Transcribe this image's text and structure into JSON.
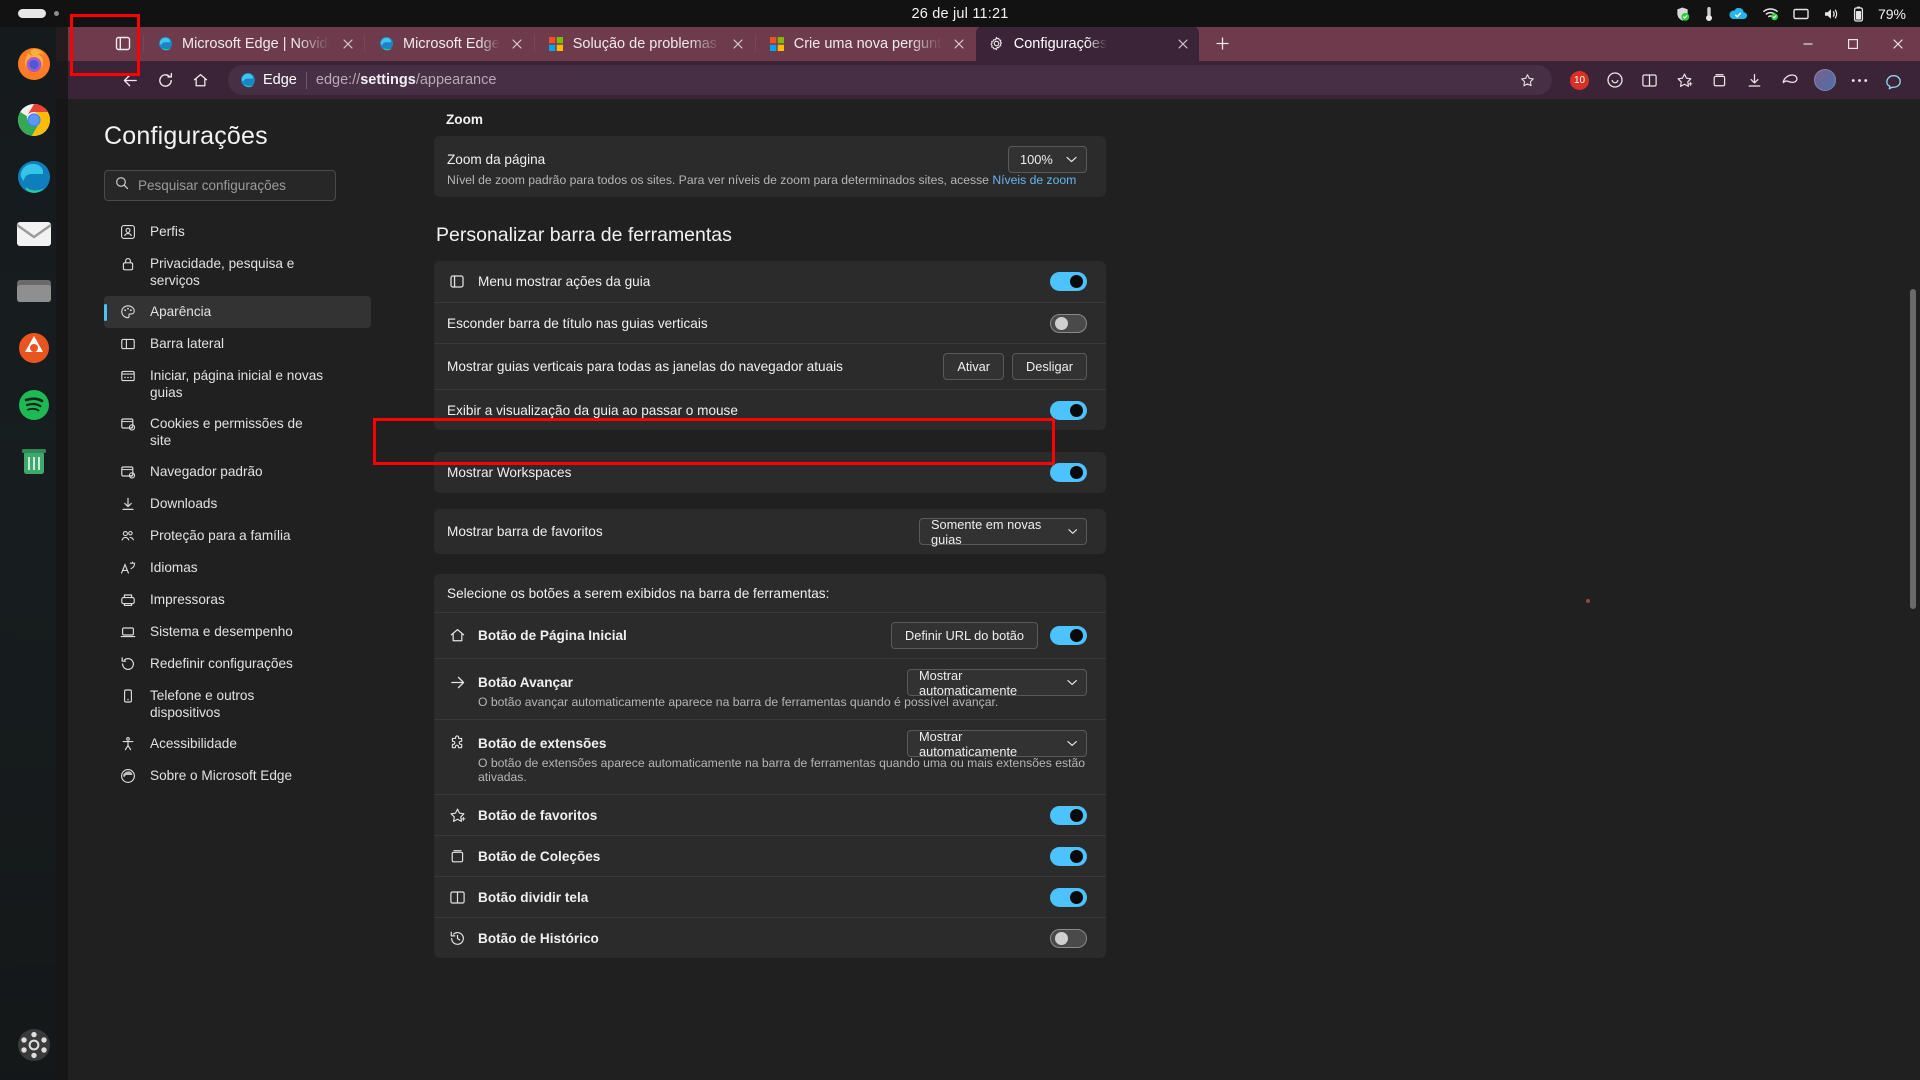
{
  "system": {
    "clock": "26 de jul  11:21",
    "battery_percent": "79%",
    "tray_icons": [
      "shield-check-icon",
      "thermometer-icon",
      "onedrive-cloud-icon",
      "wifi-icon",
      "tray-extra-icon",
      "speaker-icon",
      "battery-icon"
    ]
  },
  "dock": {
    "items": [
      {
        "name": "firefox",
        "label": "Firefox"
      },
      {
        "name": "chrome",
        "label": "Google Chrome"
      },
      {
        "name": "edge",
        "label": "Microsoft Edge"
      },
      {
        "name": "thunderbird",
        "label": "Thunderbird Mail"
      },
      {
        "name": "files",
        "label": "Arquivos"
      },
      {
        "name": "ubuntu-software",
        "label": "Ubuntu Software"
      },
      {
        "name": "spotify",
        "label": "Spotify"
      },
      {
        "name": "trash",
        "label": "Lixeira"
      },
      {
        "name": "show-apps",
        "label": "Mostrar Aplicativos"
      }
    ]
  },
  "browser": {
    "tab_actions_tooltip": "Ações da guia",
    "new_tab_label": "+",
    "tabs": [
      {
        "title": "Microsoft Edge | Novidades",
        "favicon": "edge-icon",
        "active": false,
        "closable": true
      },
      {
        "title": "Microsoft Edge",
        "favicon": "edge-icon",
        "active": false,
        "closable": true
      },
      {
        "title": "Solução de problemas - Su",
        "favicon": "microsoft-icon",
        "active": false,
        "closable": true
      },
      {
        "title": "Crie uma nova pergunta o",
        "favicon": "microsoft-icon",
        "active": false,
        "closable": true
      },
      {
        "title": "Configurações",
        "favicon": "gear-icon",
        "active": true,
        "closable": true
      }
    ],
    "window_controls": [
      "minimize",
      "maximize",
      "close"
    ],
    "toolbar": {
      "back": "Voltar",
      "refresh": "Atualizar",
      "home": "Página inicial",
      "omnibox_brand": "Edge",
      "url_prefix": "edge://",
      "url_bold": "settings",
      "url_suffix": "/appearance",
      "favorite_star": "Adicionar aos favoritos",
      "extension_badge": "10",
      "icons": [
        "star-icon",
        "extension-badge-icon",
        "copilot-bubble-icon",
        "split-screen-icon",
        "favorites-icon",
        "collections-icon",
        "downloads-icon",
        "browser-essentials-icon",
        "profile-avatar",
        "more-icon",
        "copilot-icon"
      ]
    }
  },
  "settings": {
    "title": "Configurações",
    "search": {
      "placeholder": "Pesquisar configurações",
      "value": ""
    },
    "nav": [
      {
        "label": "Perfis",
        "icon": "profile-icon",
        "selected": false
      },
      {
        "label": "Privacidade, pesquisa e serviços",
        "icon": "lock-icon",
        "selected": false
      },
      {
        "label": "Aparência",
        "icon": "palette-icon",
        "selected": true
      },
      {
        "label": "Barra lateral",
        "icon": "sidebar-icon",
        "selected": false
      },
      {
        "label": "Iniciar, página inicial e novas guias",
        "icon": "start-page-icon",
        "selected": false
      },
      {
        "label": "Cookies e permissões de site",
        "icon": "cookie-icon",
        "selected": false
      },
      {
        "label": "Navegador padrão",
        "icon": "default-browser-icon",
        "selected": false
      },
      {
        "label": "Downloads",
        "icon": "download-icon",
        "selected": false
      },
      {
        "label": "Proteção para a família",
        "icon": "family-icon",
        "selected": false
      },
      {
        "label": "Idiomas",
        "icon": "language-icon",
        "selected": false
      },
      {
        "label": "Impressoras",
        "icon": "printer-icon",
        "selected": false
      },
      {
        "label": "Sistema e desempenho",
        "icon": "system-icon",
        "selected": false
      },
      {
        "label": "Redefinir configurações",
        "icon": "reset-icon",
        "selected": false
      },
      {
        "label": "Telefone e outros dispositivos",
        "icon": "phone-icon",
        "selected": false
      },
      {
        "label": "Acessibilidade",
        "icon": "accessibility-icon",
        "selected": false
      },
      {
        "label": "Sobre o Microsoft Edge",
        "icon": "edge-icon",
        "selected": false
      }
    ],
    "zoom_section": {
      "heading": "Zoom",
      "row_label": "Zoom da página",
      "description_before": "Nível de zoom padrão para todos os sites. Para ver níveis de zoom para determinados sites, acesse ",
      "description_link": "Níveis de zoom",
      "select_value": "100%"
    },
    "toolbar_section": {
      "heading": "Personalizar barra de ferramentas",
      "rows": [
        {
          "label": "Menu mostrar ações da guia",
          "icon": "tab-actions-icon",
          "control": "toggle",
          "state": "on"
        },
        {
          "label": "Esconder barra de título nas guias verticais",
          "icon": null,
          "control": "toggle",
          "state": "off"
        },
        {
          "label": "Mostrar guias verticais para todas as janelas do navegador atuais",
          "icon": null,
          "control": "buttons",
          "buttons": [
            "Ativar",
            "Desligar"
          ]
        },
        {
          "label": "Exibir a visualização da guia ao passar o mouse",
          "icon": null,
          "control": "toggle",
          "state": "on"
        }
      ],
      "workspaces_row": {
        "label": "Mostrar Workspaces",
        "control": "toggle",
        "state": "on",
        "highlighted": true
      },
      "favorites_bar_row": {
        "label": "Mostrar barra de favoritos",
        "control": "select",
        "value": "Somente em novas guias"
      }
    },
    "buttons_section": {
      "heading": "Selecione os botões a serem exibidos na barra de ferramentas:",
      "rows": [
        {
          "label": "Botão de Página Inicial",
          "icon": "home-icon",
          "button": "Definir URL do botão",
          "control": "toggle",
          "state": "on",
          "description": null
        },
        {
          "label": "Botão Avançar",
          "icon": "forward-arrow-icon",
          "control": "select",
          "value": "Mostrar automaticamente",
          "description": "O botão avançar automaticamente aparece na barra de ferramentas quando é possível avançar."
        },
        {
          "label": "Botão de extensões",
          "icon": "extensions-icon",
          "control": "select",
          "value": "Mostrar automaticamente",
          "description": "O botão de extensões aparece automaticamente na barra de ferramentas quando uma ou mais extensões estão ativadas."
        },
        {
          "label": "Botão de favoritos",
          "icon": "favorites-star-icon",
          "control": "toggle",
          "state": "on",
          "description": null
        },
        {
          "label": "Botão de Coleções",
          "icon": "collections-icon",
          "control": "toggle",
          "state": "on",
          "description": null
        },
        {
          "label": "Botão dividir tela",
          "icon": "split-screen-icon",
          "control": "toggle",
          "state": "on",
          "description": null
        },
        {
          "label": "Botão de Histórico",
          "icon": "history-icon",
          "control": "toggle",
          "state": "off",
          "description": null
        }
      ]
    }
  },
  "annotations": {
    "tab_actions_box": "destaque-botao-acoes-guia",
    "workspaces_box": "destaque-mostrar-workspaces"
  }
}
